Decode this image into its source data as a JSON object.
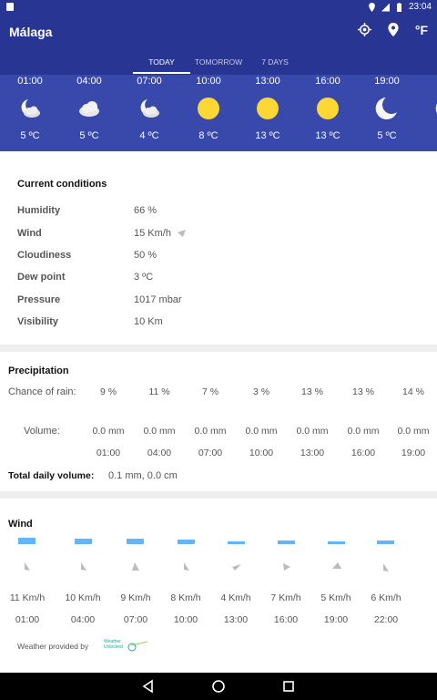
{
  "status": {
    "time": "23:04"
  },
  "app": {
    "city": "Málaga",
    "unit_label": "°F"
  },
  "tabs": [
    {
      "label": "TODAY",
      "active": true
    },
    {
      "label": "TOMORROW",
      "active": false
    },
    {
      "label": "7 DAYS",
      "active": false
    }
  ],
  "hourly": [
    {
      "time": "01:00",
      "icon": "moon-cloud-icon",
      "temp": "5 ºC"
    },
    {
      "time": "04:00",
      "icon": "cloud-icon",
      "temp": "5 ºC"
    },
    {
      "time": "07:00",
      "icon": "moon-cloud-icon",
      "temp": "4 ºC"
    },
    {
      "time": "10:00",
      "icon": "sun-icon",
      "temp": "8 ºC"
    },
    {
      "time": "13:00",
      "icon": "sun-icon",
      "temp": "13 ºC"
    },
    {
      "time": "16:00",
      "icon": "sun-icon",
      "temp": "13 ºC"
    },
    {
      "time": "19:00",
      "icon": "moon-icon",
      "temp": "5 ºC"
    },
    {
      "time": "2",
      "icon": "moon-icon",
      "temp": ""
    }
  ],
  "current": {
    "title": "Current conditions",
    "rows": [
      {
        "label": "Humidity",
        "value": "66 %"
      },
      {
        "label": "Wind",
        "value": "15 Km/h"
      },
      {
        "label": "Cloudiness",
        "value": "50 %"
      },
      {
        "label": "Dew point",
        "value": "3 ºC"
      },
      {
        "label": "Pressure",
        "value": "1017 mbar"
      },
      {
        "label": "Visibility",
        "value": "10 Km"
      }
    ]
  },
  "precipitation": {
    "title": "Precipitation",
    "chance_label": "Chance of rain:",
    "chance": [
      "9 %",
      "11 %",
      "7 %",
      "3 %",
      "13 %",
      "13 %",
      "14 %"
    ],
    "volume_label": "Volume:",
    "volumes": [
      "0.0 mm",
      "0.0 mm",
      "0.0 mm",
      "0.0 mm",
      "0.0 mm",
      "0.0 mm",
      "0.0 mm"
    ],
    "times": [
      "01:00",
      "04:00",
      "07:00",
      "10:00",
      "13:00",
      "16:00",
      "19:00"
    ],
    "total_label": "Total daily volume:",
    "total_value": "0.1 mm, 0.0 cm"
  },
  "wind": {
    "title": "Wind",
    "speed_kmh": [
      11,
      10,
      9,
      8,
      4,
      7,
      5,
      6
    ],
    "speeds": [
      "11 Km/h",
      "10 Km/h",
      "9 Km/h",
      "8 Km/h",
      "4 Km/h",
      "7 Km/h",
      "5 Km/h",
      "6 Km/h"
    ],
    "times": [
      "01:00",
      "04:00",
      "07:00",
      "10:00",
      "13:00",
      "16:00",
      "19:00",
      "22:00"
    ],
    "provider_label": "Weather provided by",
    "provider_logo_text": "Weather Unlocked"
  },
  "colors": {
    "primary": "#283593",
    "hourly_bg": "#3949ab",
    "sun": "#fdd835",
    "wind_bar": "#64b5f6"
  }
}
